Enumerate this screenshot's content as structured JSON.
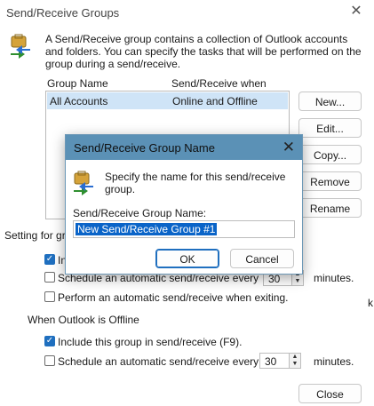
{
  "window": {
    "title": "Send/Receive Groups",
    "close_glyph": "✕",
    "description": "A Send/Receive group contains a collection of Outlook accounts and folders. You can specify the tasks that will be performed on the group during a send/receive."
  },
  "list": {
    "columns": [
      "Group Name",
      "Send/Receive when"
    ],
    "rows": [
      {
        "name": "All Accounts",
        "when": "Online and Offline"
      }
    ]
  },
  "buttons": {
    "new": "New...",
    "edit": "Edit...",
    "copy": "Copy...",
    "remove": "Remove",
    "rename": "Rename",
    "close": "Close"
  },
  "settings": {
    "group_label": "Setting for gr",
    "online_include_partial": "In",
    "online_schedule_label": "Schedule an automatic send/receive every",
    "online_minutes_value": "30",
    "minutes_label": "minutes.",
    "exit_label": "Perform an automatic send/receive when exiting.",
    "offline_heading": "When Outlook is Offline",
    "offline_include_label": "Include this group in send/receive (F9).",
    "offline_schedule_label": "Schedule an automatic send/receive every",
    "offline_minutes_value": "30",
    "edge_fragment": "k"
  },
  "dialog": {
    "title": "Send/Receive Group Name",
    "close_glyph": "✕",
    "prompt": "Specify the name for this send/receive group.",
    "field_label": "Send/Receive Group Name:",
    "field_value": "New Send/Receive Group #1",
    "ok": "OK",
    "cancel": "Cancel"
  },
  "colors": {
    "accent": "#1f6fbf",
    "dialog_title_bg": "#5b91b6",
    "list_selected_bg": "#cfe4f7"
  }
}
